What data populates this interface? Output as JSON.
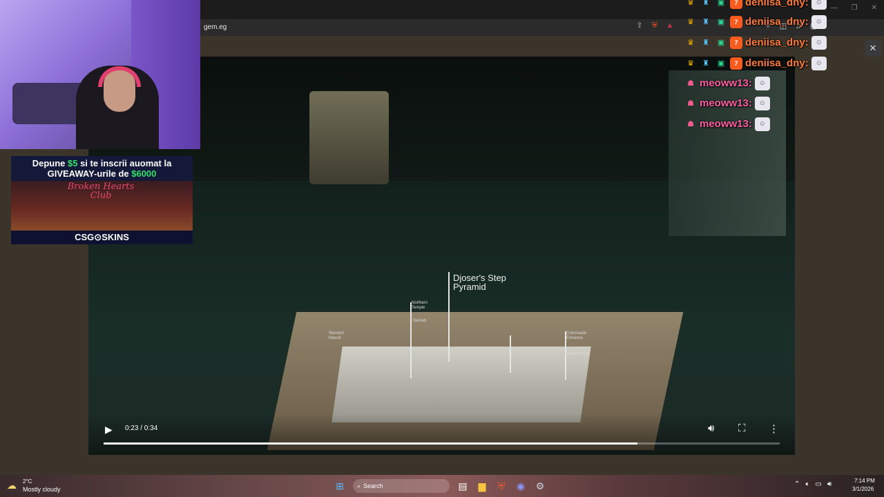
{
  "browser": {
    "url": "gem.eg"
  },
  "video": {
    "holo_label": "Djoser's Step Pyramid",
    "small_labels": [
      "Northern Temple",
      "Western Massif",
      "Serdab",
      "Colonnade Entrance",
      "Entrance Hall"
    ],
    "time": "0:23 / 0:34",
    "progress": 0.79
  },
  "sponsor": {
    "line1_prefix": "Depune ",
    "line1_amount": "$5",
    "line1_suffix": " si te inscrii auomat la",
    "line2_prefix": "GIVEAWAY-urile de ",
    "line2_amount": "$6000",
    "neon": "Broken Hearts Club",
    "brand": "CSG⊙SKINS"
  },
  "chat": {
    "rows": [
      {
        "user": "deniisa_dny:",
        "color": "orange"
      },
      {
        "user": "deniisa_dny:",
        "color": "orange"
      },
      {
        "user": "deniisa_dny:",
        "color": "orange"
      },
      {
        "user": "deniisa_dny:",
        "color": "orange"
      },
      {
        "user": "meoww13:",
        "color": "pink"
      },
      {
        "user": "meoww13:",
        "color": "pink"
      },
      {
        "user": "meoww13:",
        "color": "pink"
      }
    ]
  },
  "taskbar": {
    "temp": "2°C",
    "weather": "Mostly cloudy",
    "search": "Search",
    "time": "7:14 PM",
    "date": "3/1/2026"
  },
  "colors": {
    "accent_orange": "#ff7a3c",
    "accent_pink": "#ff5fa0",
    "sponsor_green": "#35e06a"
  }
}
